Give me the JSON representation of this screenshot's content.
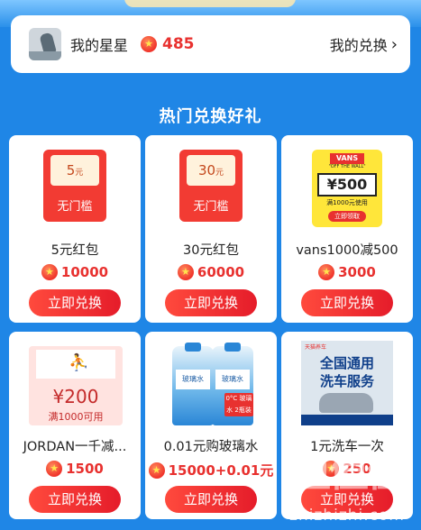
{
  "header": {
    "my_stars_label": "我的星星",
    "stars_count": "485",
    "my_exchange_label": "我的兑换"
  },
  "section_title": "热门兑换好礼",
  "products": [
    {
      "name": "5元红包",
      "price": "10000",
      "button": "立即兑换",
      "thumb": {
        "amount": "5",
        "unit": "元",
        "sub": "无门槛"
      }
    },
    {
      "name": "30元红包",
      "price": "60000",
      "button": "立即兑换",
      "thumb": {
        "amount": "30",
        "unit": "元",
        "sub": "无门槛"
      }
    },
    {
      "name": "vans1000减500",
      "price": "3000",
      "button": "立即兑换",
      "thumb": {
        "logo": "VANS",
        "tag": "\"OFF THE WALL\"",
        "amount": "¥500",
        "cond": "满1000元使用",
        "cta": "立即领取"
      }
    },
    {
      "name": "JORDAN一千减...",
      "price": "1500",
      "button": "立即兑换",
      "thumb": {
        "amount": "¥200",
        "cond": "满1000可用"
      }
    },
    {
      "name": "0.01元购玻璃水",
      "price": "15000+0.01元",
      "button": "立即兑换",
      "thumb": {
        "label": "玻璃水",
        "badge": "0°C 玻璃水 2瓶装"
      }
    },
    {
      "name": "1元洗车一次",
      "price": "250",
      "button": "立即兑换",
      "thumb": {
        "brand": "天猫养车",
        "line1": "全国通用",
        "line2": "洗车服务"
      }
    }
  ],
  "watermark": {
    "text": "值值值",
    "url": "zhizhizhi.com"
  },
  "colors": {
    "background": "#1f86e6",
    "accent_red": "#e8312f",
    "card": "#ffffff"
  }
}
